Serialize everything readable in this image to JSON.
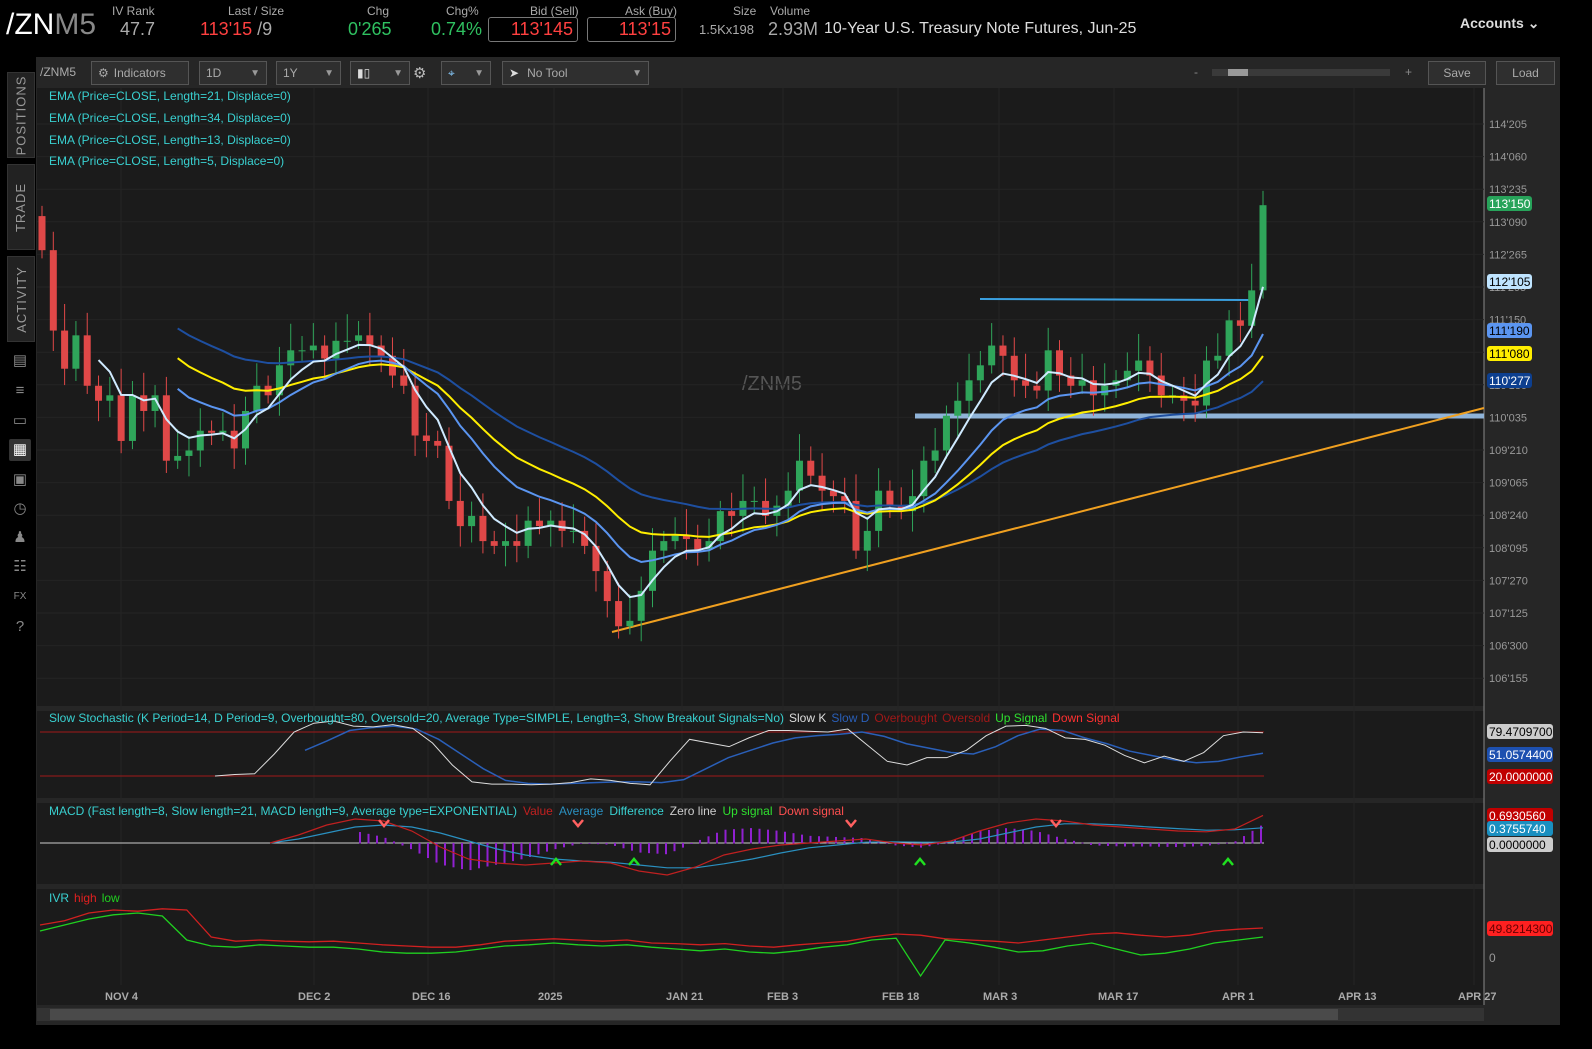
{
  "header": {
    "symbol_main": "/ZN",
    "symbol_suffix": "M5",
    "iv_rank_label": "IV Rank",
    "iv_rank": "47.7",
    "last_label": "Last / Size",
    "last": "113'15",
    "last_size": "/9",
    "chg_label": "Chg",
    "chg": "0'265",
    "chgpct_label": "Chg%",
    "chgpct": "0.74%",
    "bid_label": "Bid (Sell)",
    "bid": "113'145",
    "ask_label": "Ask (Buy)",
    "ask": "113'15",
    "size_label": "Size",
    "size": "1.5Kx198",
    "volume_label": "Volume",
    "volume": "2.93M",
    "description": "10-Year U.S. Treasury Note Futures, Jun-25",
    "accounts": "Accounts"
  },
  "sidebar": {
    "tabs": [
      "POSITIONS",
      "TRADE",
      "ACTIVITY"
    ]
  },
  "toolbar": {
    "symbol": "/ZNM5",
    "indicators": "Indicators",
    "aggregation": "1D",
    "timeframe": "1Y",
    "tool": "No Tool",
    "zoom_minus": "-",
    "zoom_plus": "+",
    "save": "Save",
    "load": "Load"
  },
  "chart": {
    "watermark": "/ZNM5",
    "ema_legend": [
      "EMA (Price=CLOSE, Length=21, Displace=0)",
      "EMA (Price=CLOSE, Length=34, Displace=0)",
      "EMA (Price=CLOSE, Length=13, Displace=0)",
      "EMA (Price=CLOSE, Length=5, Displace=0)"
    ],
    "price_ticks": [
      "114'205",
      "114'060",
      "113'235",
      "113'090",
      "112'265",
      "111'295",
      "111'150",
      "111'005",
      "110'180",
      "110'035",
      "109'210",
      "109'065",
      "108'240",
      "108'095",
      "107'270",
      "107'125",
      "106'300",
      "106'155"
    ],
    "price_badges": [
      {
        "text": "113'150",
        "color": "#27a35a"
      },
      {
        "text": "112'105",
        "color": "#bfe4ff"
      },
      {
        "text": "111'190",
        "color": "#5b95f0"
      },
      {
        "text": "111'080",
        "color": "#ffee00"
      },
      {
        "text": "110'277",
        "color": "#0d3f8f"
      }
    ],
    "date_labels": [
      "NOV 4",
      "DEC 2",
      "DEC 16",
      "2025",
      "JAN 21",
      "FEB 3",
      "FEB 18",
      "MAR 3",
      "MAR 17",
      "APR 1",
      "APR 13",
      "APR 27"
    ],
    "stoch_legend": {
      "title": "Slow Stochastic (K Period=14, D Period=9, Overbought=80, Oversold=20, Average Type=SIMPLE, Length=3, Show Breakout Signals=No)",
      "k": "Slow K",
      "d": "Slow D",
      "ob": "Overbought",
      "os": "Oversold",
      "up": "Up Signal",
      "down": "Down Signal"
    },
    "stoch_badges": [
      "79.4709700",
      "51.0574400",
      "20.0000000"
    ],
    "macd_legend": {
      "title": "MACD (Fast length=8, Slow length=21, MACD length=9, Average type=EXPONENTIAL)",
      "value": "Value",
      "avg": "Average",
      "diff": "Difference",
      "zero": "Zero line",
      "up": "Up signal",
      "down": "Down signal"
    },
    "macd_badges": [
      "0.6930560",
      "0.3755740",
      "0.0000000"
    ],
    "ivr_legend": {
      "title": "IVR",
      "high": "high",
      "low": "low"
    },
    "ivr_badges": [
      "49.8214300",
      "0"
    ]
  },
  "colors": {
    "up": "#2fa55a",
    "down": "#e04848",
    "ema5": "#cfeaff",
    "ema13": "#5b95f0",
    "ema21": "#ffee00",
    "ema34": "#1e4fa0",
    "trend": "#f0a020",
    "accent": "#39d0d0"
  },
  "chart_data": {
    "type": "candlestick",
    "ylim": [
      106.1,
      115.17
    ],
    "closes": [
      112.79,
      111.61,
      111.05,
      111.54,
      110.8,
      110.58,
      110.66,
      109.99,
      110.66,
      110.43,
      110.66,
      109.7,
      109.77,
      109.85,
      110.14,
      110.11,
      110.14,
      109.88,
      110.43,
      110.8,
      110.66,
      111.1,
      111.32,
      111.32,
      111.39,
      111.2,
      111.46,
      111.46,
      111.54,
      111.39,
      111.24,
      110.95,
      110.8,
      110.07,
      109.99,
      109.92,
      109.11,
      108.74,
      108.89,
      108.52,
      108.45,
      108.52,
      108.45,
      108.82,
      108.74,
      108.82,
      108.67,
      108.67,
      108.45,
      108.08,
      107.64,
      107.27,
      107.35,
      107.79,
      108.38,
      108.52,
      108.6,
      108.55,
      108.4,
      108.52,
      108.96,
      108.89,
      109.11,
      109.11,
      108.89,
      109.04,
      109.26,
      109.7,
      109.48,
      109.26,
      109.18,
      109.11,
      108.38,
      108.67,
      109.26,
      109.04,
      108.96,
      109.18,
      109.7,
      109.85,
      110.36,
      110.58,
      110.88,
      111.1,
      111.39,
      111.24,
      110.88,
      110.8,
      110.73,
      111.32,
      110.95,
      110.8,
      110.88,
      110.66,
      110.8,
      110.88,
      111.02,
      111.17,
      110.95,
      110.66,
      110.66,
      110.58,
      110.51,
      111.17,
      111.24,
      111.76,
      111.68,
      112.2,
      113.45
    ],
    "stoch_k": [
      20,
      22,
      23,
      50,
      80,
      92,
      95,
      88,
      87,
      90,
      85,
      65,
      35,
      12,
      9,
      9,
      8,
      9,
      11,
      16,
      14,
      10,
      8,
      40,
      70,
      65,
      60,
      72,
      82,
      82,
      81,
      80,
      84,
      62,
      40,
      35,
      45,
      45,
      55,
      75,
      88,
      89,
      85,
      72,
      70,
      62,
      48,
      38,
      47,
      40,
      52,
      75,
      80,
      79
    ],
    "stoch_d": [
      55,
      68,
      82,
      86,
      88,
      84,
      70,
      50,
      30,
      14,
      10,
      9,
      10,
      11,
      12,
      12,
      11,
      15,
      30,
      45,
      55,
      65,
      72,
      75,
      77,
      80,
      74,
      64,
      58,
      52,
      50,
      60,
      75,
      84,
      82,
      72,
      64,
      54,
      48,
      42,
      38,
      40,
      46,
      51
    ],
    "macd_value": [
      0,
      0.2,
      0.45,
      0.6,
      0.55,
      0.3,
      -0.1,
      -0.4,
      -0.5,
      -0.55,
      -0.5,
      -0.45,
      -0.5,
      -0.7,
      -0.8,
      -0.6,
      -0.3,
      -0.15,
      -0.05,
      0,
      0.05,
      0.1,
      0.0,
      -0.05,
      0.05,
      0.3,
      0.5,
      0.6,
      0.55,
      0.45,
      0.4,
      0.35,
      0.3,
      0.28,
      0.35,
      0.69
    ],
    "macd_avg": [
      0,
      0.1,
      0.25,
      0.4,
      0.45,
      0.4,
      0.25,
      0.05,
      -0.15,
      -0.3,
      -0.4,
      -0.45,
      -0.48,
      -0.55,
      -0.62,
      -0.62,
      -0.52,
      -0.4,
      -0.25,
      -0.12,
      -0.05,
      0.02,
      0.03,
      0.02,
      0.02,
      0.1,
      0.25,
      0.4,
      0.48,
      0.48,
      0.45,
      0.4,
      0.36,
      0.32,
      0.33,
      0.38
    ],
    "ivr_high": [
      55,
      62,
      75,
      80,
      78,
      82,
      80,
      35,
      28,
      30,
      28,
      27,
      28,
      25,
      22,
      20,
      18,
      18,
      22,
      28,
      30,
      32,
      30,
      28,
      30,
      25,
      24,
      22,
      24,
      20,
      18,
      22,
      25,
      28,
      35,
      40,
      38,
      32,
      30,
      28,
      25,
      30,
      35,
      40,
      42,
      38,
      35,
      38,
      45,
      48,
      50
    ],
    "ivr_low": [
      45,
      55,
      65,
      72,
      75,
      70,
      30,
      20,
      18,
      22,
      20,
      18,
      18,
      15,
      10,
      8,
      8,
      10,
      15,
      20,
      22,
      25,
      22,
      20,
      22,
      18,
      15,
      12,
      15,
      10,
      8,
      12,
      18,
      22,
      30,
      33,
      -30,
      30,
      25,
      18,
      10,
      12,
      20,
      25,
      15,
      5,
      8,
      15,
      25,
      30,
      35
    ]
  }
}
